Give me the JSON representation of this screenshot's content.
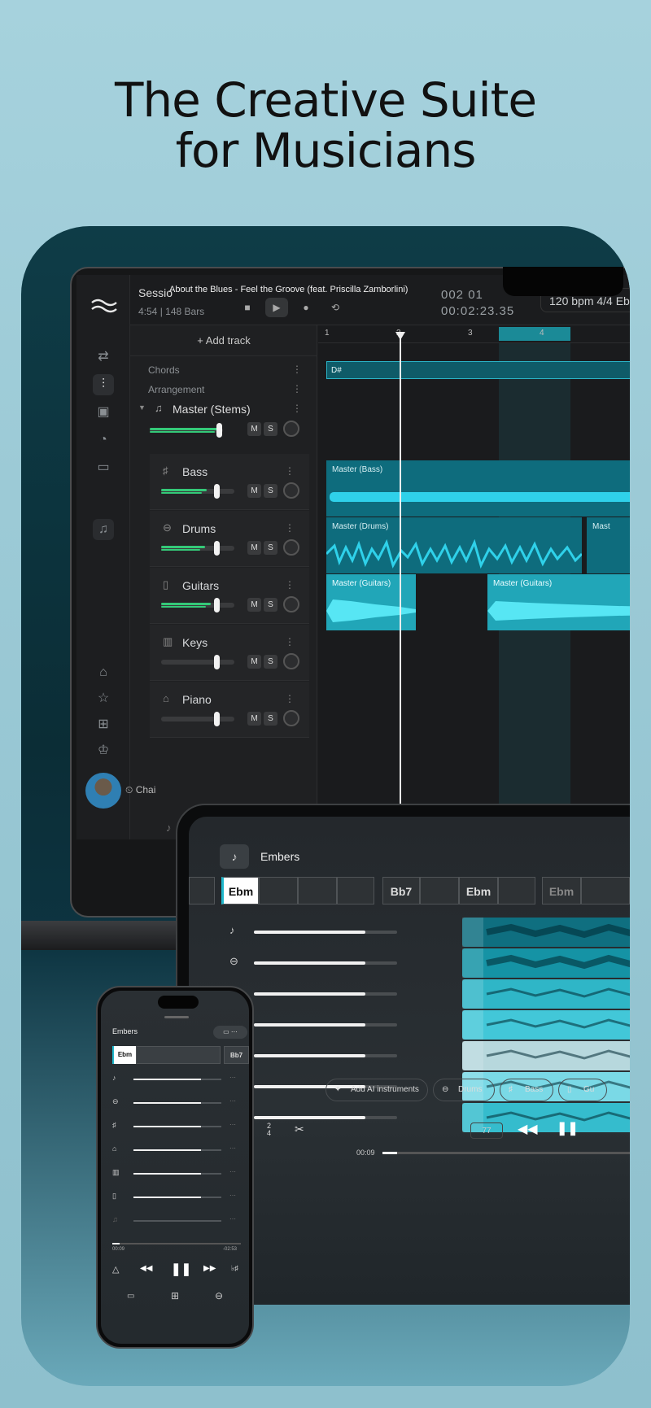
{
  "headline": {
    "line1": "The Creative Suite",
    "line2": "for Musicians"
  },
  "laptop": {
    "session_label": "Sessio",
    "session_length": "4:54",
    "session_bars": "148 Bars",
    "song_title": "About the Blues - Feel the Groove (feat. Priscilla Zamborlini)",
    "position": "002  01",
    "time": "00:02:23.35",
    "tempo": "120 bpm 4/4 Eb",
    "add_track": "+ Add track",
    "chords_label": "Chords",
    "arrangement_label": "Arrangement",
    "master_label": "Master (Stems)",
    "chord_block": "D#",
    "ruler": [
      "1",
      "2",
      "3",
      "4"
    ],
    "tracks": [
      {
        "name": "Bass",
        "icon": "bass-icon",
        "level": 0.62,
        "fader": 0.76
      },
      {
        "name": "Drums",
        "icon": "drums-icon",
        "level": 0.6,
        "fader": 0.76
      },
      {
        "name": "Guitars",
        "icon": "guitar-icon",
        "level": 0.68,
        "fader": 0.76
      },
      {
        "name": "Keys",
        "icon": "keys-icon",
        "level": 0,
        "fader": 0.76
      },
      {
        "name": "Piano",
        "icon": "piano-icon",
        "level": 0,
        "fader": 0.76
      }
    ],
    "clips": {
      "bass": "Master (Bass)",
      "drums": "Master (Drums)",
      "drums2": "Mast",
      "guitars": "Master (Guitars)",
      "guitars2": "Master (Guitars)"
    },
    "chain_label": "Chai",
    "mute": "M",
    "solo": "S"
  },
  "tablet": {
    "title": "Embers",
    "chords": [
      "Ebm",
      "Bb7",
      "Ebm",
      "Ebm"
    ],
    "add_ai": "Add AI instruments",
    "pill_drums": "Drums",
    "pill_bass": "Bass",
    "pill_guitar": "Gu",
    "tempo": "77",
    "time": "00:09",
    "meter_top": "2",
    "meter_bottom": "4",
    "track_levels": [
      0.78,
      0.78,
      0.78,
      0.78,
      0.78,
      0.78,
      0.78
    ]
  },
  "phone": {
    "title": "Embers",
    "chords": [
      "Ebm",
      "Bb7"
    ],
    "time_start": "00:09",
    "time_end": "-02:53",
    "progress": 0.06,
    "track_levels": [
      0.77,
      0.77,
      0.77,
      0.77,
      0.77,
      0.77,
      0.77
    ]
  },
  "colors": {
    "accent": "#1fb8cc",
    "level_green": "#34c978",
    "stage": "#0e3c47"
  }
}
